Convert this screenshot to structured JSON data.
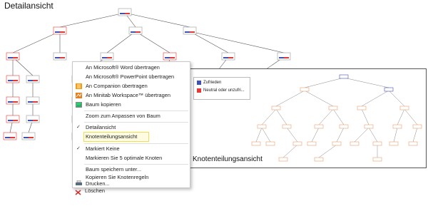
{
  "detail_title": "Detailansicht",
  "node_split_title": "Knotenteilungsansicht",
  "colors": {
    "satisfied": "#3f51b5",
    "neutral": "#e53935",
    "highlight": "#f0e14a"
  },
  "legend": [
    {
      "label": "Zufrieden",
      "color": "#3f51b5"
    },
    {
      "label": "Neutral oder unzufri...",
      "color": "#e53935"
    }
  ],
  "menu": {
    "items": [
      {
        "label": "An Microsoft® Word übertragen",
        "icon": "none"
      },
      {
        "label": "An Microsoft® PowerPoint übertragen",
        "icon": "none"
      },
      {
        "label": "An Companion übertragen",
        "icon": "companion-icon"
      },
      {
        "label": "An Minitab Workspace™ übertragen",
        "icon": "workspace-icon"
      },
      {
        "label": "Baum kopieren",
        "icon": "copy-tree-icon"
      },
      {
        "label": "Zoom zum Anpassen von Baum",
        "icon": "none"
      },
      {
        "label": "Detailansicht",
        "icon": "check-icon"
      },
      {
        "label": "Knotenteilungsansicht",
        "icon": "none"
      },
      {
        "label": "Markiert Keine",
        "icon": "check-icon"
      },
      {
        "label": "Markieren Sie 5 optimale Knoten",
        "icon": "none"
      },
      {
        "label": "Baum speichern unter...",
        "icon": "none"
      },
      {
        "label": "Kopieren Sie Knotenregeln",
        "icon": "none"
      },
      {
        "label": "Drucken...",
        "icon": "printer-icon"
      },
      {
        "label": "Löschen",
        "icon": "delete-icon"
      }
    ]
  }
}
